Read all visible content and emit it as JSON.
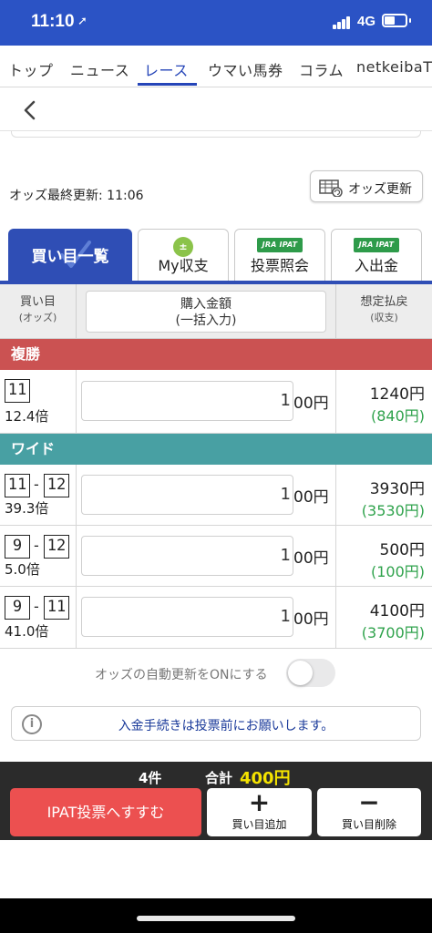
{
  "status_bar": {
    "time": "11:10",
    "location_glyph": "➚",
    "network": "4G"
  },
  "nav": {
    "tabs": [
      {
        "label": "トップ"
      },
      {
        "label": "ニュース"
      },
      {
        "label": "レース"
      },
      {
        "label": "ウマい馬券"
      },
      {
        "label": "コラム"
      },
      {
        "label": "netkeibaT"
      }
    ],
    "active_index": 2
  },
  "odds": {
    "updated_label": "オッズ最終更新: 11:06",
    "refresh_label": "オッズ更新"
  },
  "func_tabs": [
    {
      "label": "買い目一覧"
    },
    {
      "label": "My収支"
    },
    {
      "badge": "JRA IPAT",
      "label": "投票照会"
    },
    {
      "badge": "JRA IPAT",
      "label": "入出金"
    }
  ],
  "table_header": {
    "eye": "買い目",
    "eye_sub": "(オッズ)",
    "amount": "購入金額",
    "amount_sub": "(一括入力)",
    "pay": "想定払戻",
    "pay_sub": "(収支)"
  },
  "sections": [
    {
      "name": "複勝",
      "color": "#cb5252",
      "bets": [
        {
          "nums": [
            "11"
          ],
          "odds": "12.4倍",
          "amount": "1",
          "suffix": "00円",
          "payout": "1240円",
          "net": "(840円)"
        }
      ]
    },
    {
      "name": "ワイド",
      "color": "#48a0a3",
      "bets": [
        {
          "nums": [
            "11",
            "12"
          ],
          "odds": "39.3倍",
          "amount": "1",
          "suffix": "00円",
          "payout": "3930円",
          "net": "(3530円)"
        },
        {
          "nums": [
            "9",
            "12"
          ],
          "odds": "5.0倍",
          "amount": "1",
          "suffix": "00円",
          "payout": "500円",
          "net": "(100円)"
        },
        {
          "nums": [
            "9",
            "11"
          ],
          "odds": "41.0倍",
          "amount": "1",
          "suffix": "00円",
          "payout": "4100円",
          "net": "(3700円)"
        }
      ]
    }
  ],
  "auto_update": {
    "label": "オッズの自動更新をONにする",
    "on": false
  },
  "notice": "入金手続きは投票前にお願いします。",
  "footer": {
    "count": "4件",
    "total_label": "合計",
    "total_value": "400円",
    "ipat_button": "IPAT投票へすすむ",
    "add_label": "買い目追加",
    "delete_label": "買い目削除"
  }
}
